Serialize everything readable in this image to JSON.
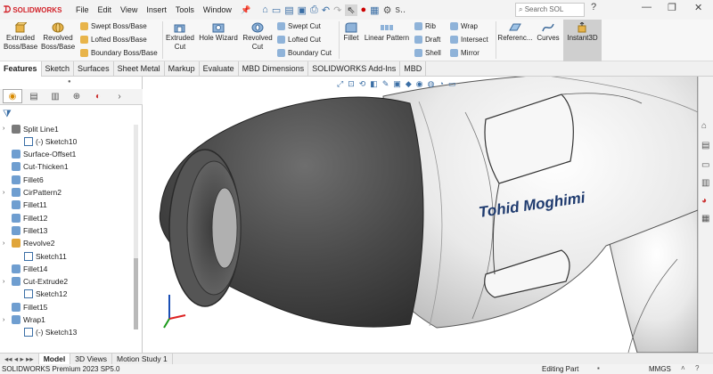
{
  "app": {
    "logo_text": "SOLIDWORKS",
    "menu": [
      "File",
      "Edit",
      "View",
      "Insert",
      "Tools",
      "Window"
    ],
    "search_placeholder": "Search SOL"
  },
  "commandmanager": {
    "extruded_boss": "Extruded Boss/Base",
    "revolved_boss": "Revolved Boss/Base",
    "swept_boss": "Swept Boss/Base",
    "lofted_boss": "Lofted Boss/Base",
    "boundary_boss": "Boundary Boss/Base",
    "extruded_cut": "Extruded Cut",
    "hole_wizard": "Hole Wizard",
    "revolved_cut": "Revolved Cut",
    "swept_cut": "Swept Cut",
    "lofted_cut": "Lofted Cut",
    "boundary_cut": "Boundary Cut",
    "fillet": "Fillet",
    "linear_pattern": "Linear Pattern",
    "rib": "Rib",
    "draft": "Draft",
    "shell": "Shell",
    "wrap": "Wrap",
    "intersect": "Intersect",
    "mirror": "Mirror",
    "reference": "Referenc...",
    "curves": "Curves",
    "instant3d": "Instant3D"
  },
  "tabs": [
    "Features",
    "Sketch",
    "Surfaces",
    "Sheet Metal",
    "Markup",
    "Evaluate",
    "MBD Dimensions",
    "SOLIDWORKS Add-Ins",
    "MBD"
  ],
  "tree": [
    {
      "label": "Split Line1",
      "icon": "split-line-icon",
      "level": 0,
      "caret": "›"
    },
    {
      "label": "(-) Sketch10",
      "icon": "sketch-icon",
      "level": 1,
      "caret": ""
    },
    {
      "label": "Surface-Offset1",
      "icon": "surface-offset-icon",
      "level": 0,
      "caret": ""
    },
    {
      "label": "Cut-Thicken1",
      "icon": "cut-thicken-icon",
      "level": 0,
      "caret": ""
    },
    {
      "label": "Fillet6",
      "icon": "fillet-icon",
      "level": 0,
      "caret": ""
    },
    {
      "label": "CirPattern2",
      "icon": "circular-pattern-icon",
      "level": 0,
      "caret": "›"
    },
    {
      "label": "Fillet11",
      "icon": "fillet-icon",
      "level": 0,
      "caret": ""
    },
    {
      "label": "Fillet12",
      "icon": "fillet-icon",
      "level": 0,
      "caret": ""
    },
    {
      "label": "Fillet13",
      "icon": "fillet-icon",
      "level": 0,
      "caret": ""
    },
    {
      "label": "Revolve2",
      "icon": "revolve-icon",
      "level": 0,
      "caret": "›"
    },
    {
      "label": "Sketch11",
      "icon": "sketch-icon",
      "level": 1,
      "caret": ""
    },
    {
      "label": "Fillet14",
      "icon": "fillet-icon",
      "level": 0,
      "caret": ""
    },
    {
      "label": "Cut-Extrude2",
      "icon": "cut-extrude-icon",
      "level": 0,
      "caret": "›"
    },
    {
      "label": "Sketch12",
      "icon": "sketch-icon",
      "level": 1,
      "caret": ""
    },
    {
      "label": "Fillet15",
      "icon": "fillet-icon",
      "level": 0,
      "caret": ""
    },
    {
      "label": "Wrap1",
      "icon": "wrap-icon",
      "level": 0,
      "caret": "›"
    },
    {
      "label": "(-) Sketch13",
      "icon": "sketch-icon",
      "level": 1,
      "caret": ""
    }
  ],
  "model": {
    "wrap_text": "Tohid Moghimi"
  },
  "bottom_tabs": [
    "Model",
    "3D Views",
    "Motion Study 1"
  ],
  "status": {
    "version": "SOLIDWORKS Premium 2023 SP5.0",
    "mode": "Editing Part",
    "units": "MMGS"
  }
}
